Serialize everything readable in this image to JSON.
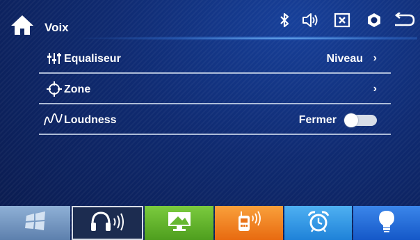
{
  "header": {
    "title": "Voix",
    "icons": [
      "home-icon",
      "bluetooth-icon",
      "volume-icon",
      "mute-icon",
      "settings-icon",
      "back-icon"
    ]
  },
  "rows": [
    {
      "label": "Equaliseur",
      "value": "Niveau",
      "chevron": "›",
      "icon": "equalizer-icon"
    },
    {
      "label": "Zone",
      "value": "",
      "chevron": "›",
      "icon": "crosshair-icon"
    },
    {
      "label": "Loudness",
      "value": "Fermer",
      "toggle_on": false,
      "icon": "loudness-wave-icon"
    }
  ],
  "dock": {
    "selected": "audio",
    "tiles": [
      {
        "id": "apps",
        "icon": "windows-icon",
        "color": "#6d8fb8"
      },
      {
        "id": "audio",
        "icon": "headphones-sound-icon",
        "color": "#1e2f55"
      },
      {
        "id": "display",
        "icon": "monitor-icon",
        "color": "#5cae2a"
      },
      {
        "id": "phone",
        "icon": "bluetooth-phone-icon",
        "color": "#f07a1a"
      },
      {
        "id": "alarm",
        "icon": "alarm-clock-icon",
        "color": "#2d93e6"
      },
      {
        "id": "light",
        "icon": "lightbulb-icon",
        "color": "#1f6bd8"
      }
    ]
  }
}
